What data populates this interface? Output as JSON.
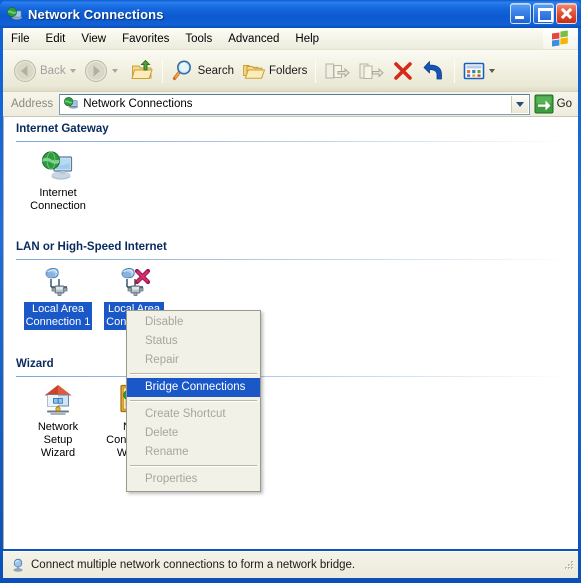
{
  "window": {
    "title": "Network Connections",
    "title_icon": "network-globe-icon",
    "buttons": {
      "minimize": "Minimize",
      "maximize": "Maximize",
      "close": "Close"
    },
    "accent_color": "#1a58c8",
    "titlebar_color": "#1668dd",
    "selection_color": "#1a58c8"
  },
  "menubar": {
    "items": [
      {
        "label": "File"
      },
      {
        "label": "Edit"
      },
      {
        "label": "View"
      },
      {
        "label": "Favorites"
      },
      {
        "label": "Tools"
      },
      {
        "label": "Advanced"
      },
      {
        "label": "Help"
      }
    ],
    "logo": "windows-flag-icon"
  },
  "toolbar": {
    "back": {
      "label": "Back",
      "icon": "back-arrow-icon",
      "enabled": false
    },
    "forward": {
      "label": "",
      "icon": "forward-arrow-icon",
      "enabled": false
    },
    "up": {
      "label": "",
      "icon": "up-folder-icon",
      "enabled": true
    },
    "search": {
      "label": "Search",
      "icon": "search-icon",
      "enabled": true
    },
    "folders": {
      "label": "Folders",
      "icon": "folders-icon",
      "enabled": true
    },
    "move_to": {
      "label": "",
      "icon": "move-to-folder-icon",
      "enabled": false
    },
    "copy_to": {
      "label": "",
      "icon": "copy-to-folder-icon",
      "enabled": false
    },
    "delete": {
      "label": "",
      "icon": "delete-x-icon",
      "enabled": true
    },
    "undo": {
      "label": "",
      "icon": "undo-arrow-icon",
      "enabled": true
    },
    "views": {
      "label": "",
      "icon": "views-icon",
      "enabled": true
    }
  },
  "addressbar": {
    "label": "Address",
    "value": "Network Connections",
    "icon": "network-globe-icon",
    "dropdown": "chevron-down-icon",
    "go_label": "Go",
    "go_icon": "go-arrow-icon"
  },
  "content": {
    "groups": [
      {
        "title": "Internet Gateway",
        "items": [
          {
            "caption": "Internet\nConnection",
            "icon": "internet-connection-icon",
            "selected": false
          }
        ]
      },
      {
        "title": "LAN or High-Speed Internet",
        "items": [
          {
            "caption": "Local Area\nConnection 1",
            "icon": "lan-connection-icon",
            "selected": true
          },
          {
            "caption": "Local Area\nConnection",
            "icon": "lan-connection-disconnected-icon",
            "selected": true
          }
        ]
      },
      {
        "title": "Wizard",
        "items": [
          {
            "caption": "Network Setup\nWizard",
            "icon": "network-setup-wizard-icon",
            "selected": false
          },
          {
            "caption": "New\nConnection Wizard",
            "icon": "new-connection-wizard-icon",
            "selected": false
          }
        ]
      }
    ]
  },
  "context_menu": {
    "items": [
      {
        "label": "Disable",
        "enabled": false,
        "highlighted": false
      },
      {
        "label": "Status",
        "enabled": false,
        "highlighted": false
      },
      {
        "label": "Repair",
        "enabled": false,
        "highlighted": false
      },
      {
        "separator": true
      },
      {
        "label": "Bridge Connections",
        "enabled": true,
        "highlighted": true
      },
      {
        "separator": true
      },
      {
        "label": "Create Shortcut",
        "enabled": false,
        "highlighted": false
      },
      {
        "label": "Delete",
        "enabled": false,
        "highlighted": false
      },
      {
        "label": "Rename",
        "enabled": false,
        "highlighted": false
      },
      {
        "separator": true
      },
      {
        "label": "Properties",
        "enabled": false,
        "highlighted": false
      }
    ]
  },
  "statusbar": {
    "text": "Connect multiple network connections to form a network bridge.",
    "icon": "network-bridge-icon"
  }
}
